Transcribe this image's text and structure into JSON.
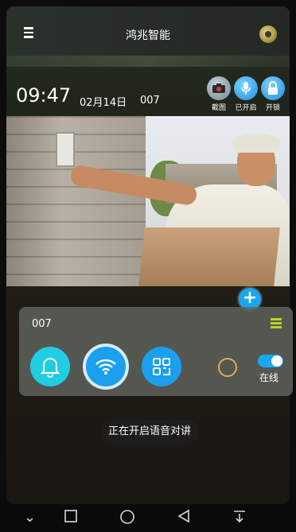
{
  "header": {
    "title": "鸿兆智能"
  },
  "info": {
    "time": "09:47",
    "date": "02月14日",
    "device_id": "007"
  },
  "toolbar": {
    "screenshot_label": "截图",
    "mic_label": "已开启",
    "unlock_label": "开锁"
  },
  "device_panel": {
    "name": "007",
    "status": "在线",
    "online": true
  },
  "toast": "正在开启语音对讲",
  "colors": {
    "accent_blue": "#1b9fee",
    "bell_cyan": "#20cde3",
    "list_icon_green": "#b9d425",
    "ring_gold": "#d8b34b"
  },
  "icons": {
    "menu": "menu-icon",
    "settings": "settings-icon",
    "screenshot": "camera-icon",
    "mic": "microphone-icon",
    "unlock": "lock-icon",
    "add": "plus-icon",
    "list": "list-icon",
    "bell": "bell-icon",
    "wifi": "wifi-icon",
    "qr": "qr-code-icon"
  }
}
